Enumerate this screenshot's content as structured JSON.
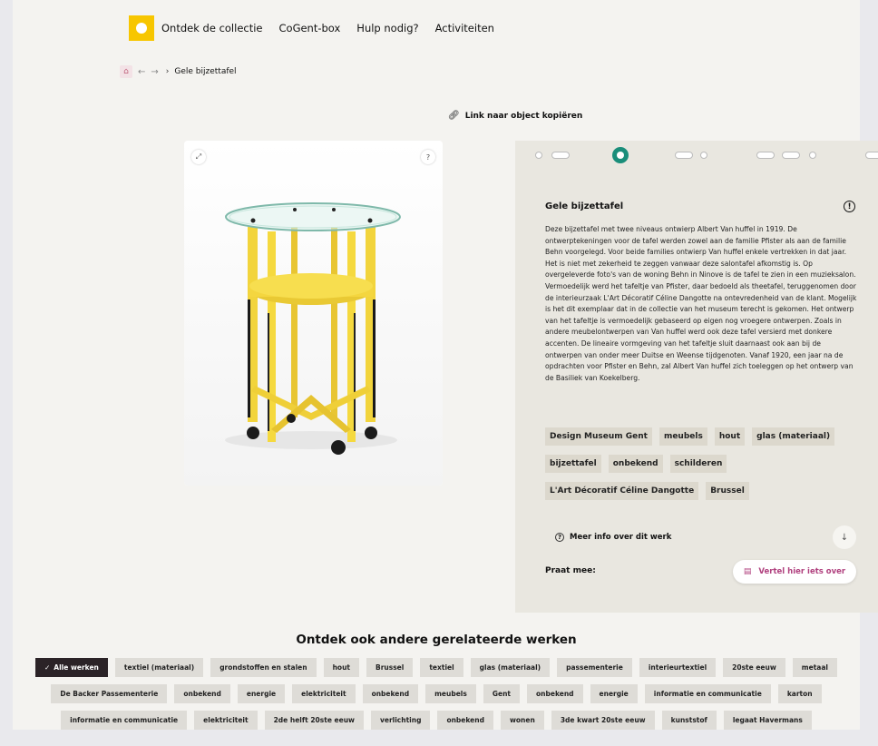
{
  "nav": {
    "items": [
      "Ontdek de collectie",
      "CoGent-box",
      "Hulp nodig?",
      "Activiteiten"
    ]
  },
  "breadcrumb": {
    "current": "Gele bijzettafel"
  },
  "copy_link": "Link naar object kopiëren",
  "object": {
    "title": "Gele bijzettafel",
    "description": "Deze bijzettafel met twee niveaus ontwierp Albert Van huffel in 1919. De ontwerptekeningen voor de tafel werden zowel aan de familie Pfister als aan de familie Behn voorgelegd. Voor beide families ontwierp Van huffel enkele vertrekken in dat jaar. Het is niet met zekerheid te zeggen vanwaar deze salontafel afkomstig is. Op overgeleverde foto's van de woning Behn in Ninove is de tafel te zien in een muzieksalon. Vermoedelijk werd het tafeltje van Pfister, daar bedoeld als theetafel, teruggenomen door de interieurzaak L'Art Décoratif Céline Dangotte na ontevredenheid van de klant. Mogelijk is het dit exemplaar dat in de collectie van het museum terecht is gekomen. Het ontwerp van het tafeltje is vermoedelijk gebaseerd op eigen nog vroegere ontwerpen. Zoals in andere meubelontwerpen van Van huffel werd ook deze tafel versierd met donkere accenten. De lineaire vormgeving van het tafeltje sluit daarnaast ook aan bij de ontwerpen van onder meer Duitse en Weense tijdgenoten. Vanaf 1920, een jaar na de opdrachten voor Pfister en Behn, zal Albert Van huffel zich toeleggen op het ontwerp van de Basiliek van Koekelberg.",
    "tags": [
      [
        "Design Museum Gent",
        "meubels",
        "hout",
        "glas (materiaal)"
      ],
      [
        "bijzettafel",
        "onbekend",
        "schilderen"
      ],
      [
        "L'Art Décoratif Céline Dangotte",
        "Brussel"
      ]
    ],
    "more_info": "Meer info over dit werk",
    "praat_mee": "Praat mee:",
    "vertel_button": "Vertel hier iets over"
  },
  "related": {
    "title": "Ontdek ook andere gerelateerde werken",
    "rows": [
      [
        "Alle werken",
        "textiel (materiaal)",
        "grondstoffen en stalen",
        "hout",
        "Brussel",
        "textiel",
        "glas (materiaal)",
        "passementerie",
        "interieurtextiel",
        "20ste eeuw",
        "metaal"
      ],
      [
        "De Backer Passementerie",
        "onbekend",
        "energie",
        "elektriciteit",
        "onbekend",
        "meubels",
        "Gent",
        "onbekend",
        "energie",
        "informatie en communicatie",
        "karton"
      ],
      [
        "informatie en communicatie",
        "elektriciteit",
        "2de helft 20ste eeuw",
        "verlichting",
        "onbekend",
        "wonen",
        "3de kwart 20ste eeuw",
        "kunststof",
        "legaat Havermans"
      ]
    ]
  },
  "colors": {
    "logo": "#f7c600",
    "accent_green": "#1a8e7a",
    "accent_pink": "#b0407e",
    "active_chip": "#2b2327"
  },
  "icons": [
    "home-icon",
    "back-arrow-icon",
    "forward-arrow-icon",
    "link-icon",
    "expand-icon",
    "help-icon",
    "info-icon",
    "arrow-down-icon",
    "comment-icon",
    "check-icon"
  ]
}
